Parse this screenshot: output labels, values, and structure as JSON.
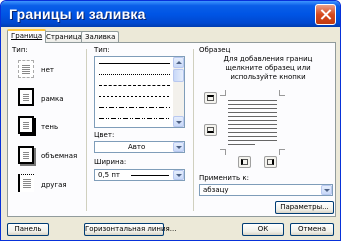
{
  "window": {
    "title": "Границы и заливка"
  },
  "tabs": [
    {
      "label": "Граница",
      "active": true
    },
    {
      "label": "Страница",
      "active": false
    },
    {
      "label": "Заливка",
      "active": false
    }
  ],
  "setting": {
    "label": "Тип:",
    "items": [
      {
        "label": "нет",
        "icon": "setting-none-icon"
      },
      {
        "label": "рамка",
        "icon": "setting-box-icon"
      },
      {
        "label": "тень",
        "icon": "setting-shadow-icon"
      },
      {
        "label": "объемная",
        "icon": "setting-3d-icon"
      },
      {
        "label": "другая",
        "icon": "setting-custom-icon"
      }
    ]
  },
  "style": {
    "label": "Тип:",
    "line_styles": [
      "solid",
      "dotted",
      "dash-small",
      "dash-large",
      "dash-dot",
      "dash-dot-dot"
    ]
  },
  "color": {
    "label": "Цвет:",
    "value": "Авто"
  },
  "width": {
    "label": "Ширина:",
    "value": "0,5 пт"
  },
  "preview": {
    "label": "Образец",
    "hint": "Для добавления границ щелкните образец или используйте кнопки"
  },
  "apply_to": {
    "label": "Применить к:",
    "value": "абзацу"
  },
  "buttons": {
    "options": "Параметры...",
    "toolbar": "Панель",
    "horizontal_line": "Горизонтальная линия...",
    "ok": "ОК",
    "cancel": "Отмена"
  },
  "colors": {
    "titlebar": "#0055e5",
    "dialog": "#ece9d8",
    "tab_highlight": "#ffc83c"
  }
}
